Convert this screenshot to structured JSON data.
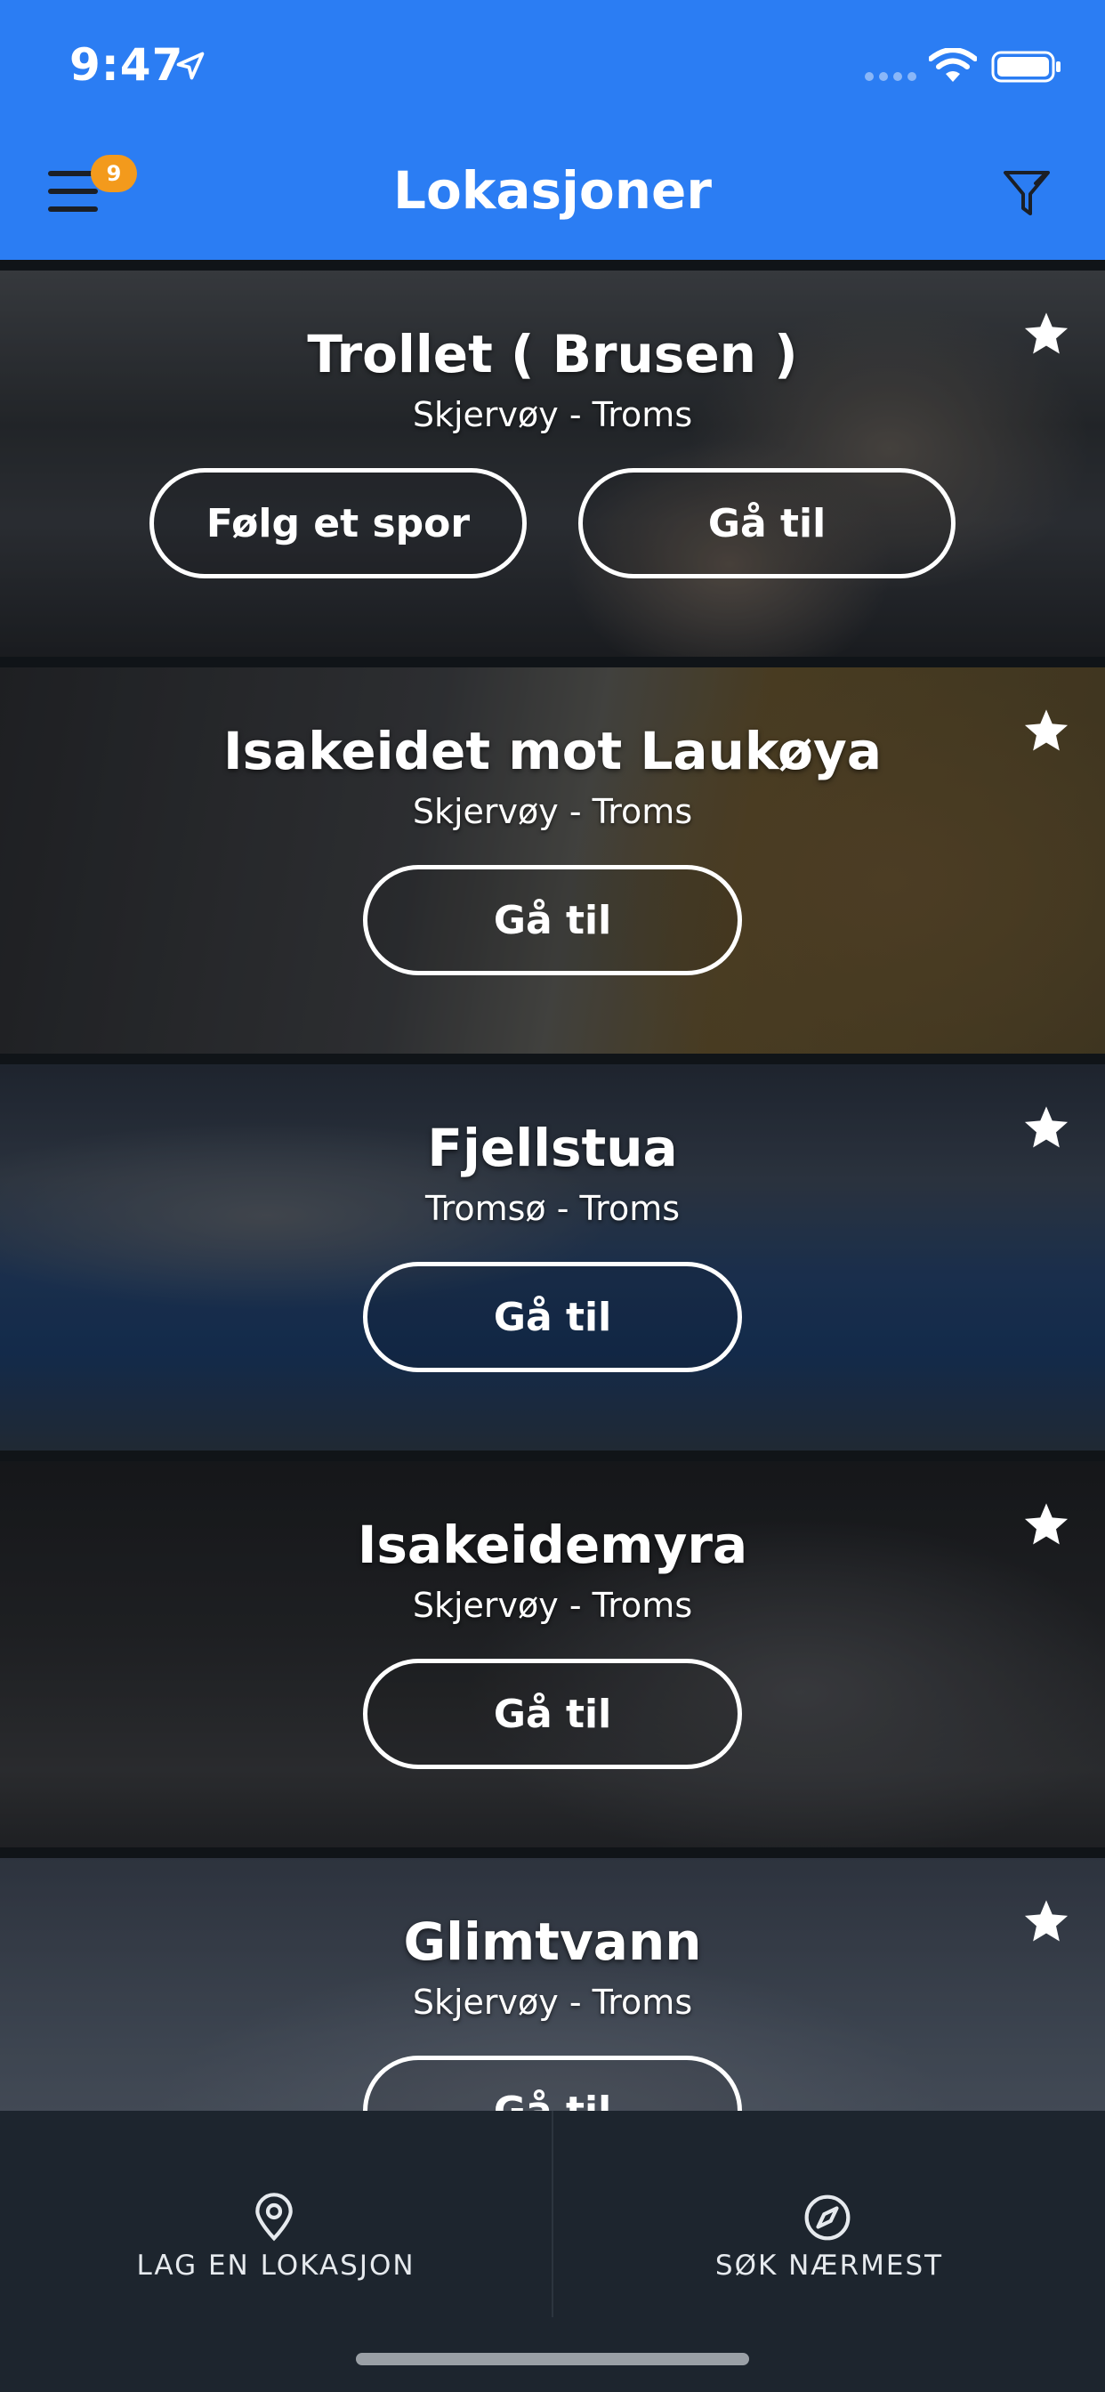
{
  "status_bar": {
    "time": "9:47"
  },
  "header": {
    "title": "Lokasjoner",
    "badge_count": "9",
    "color": "#2b7df3",
    "badge_color": "#f39a1c"
  },
  "locations": [
    {
      "name": "Trollet ( Brusen )",
      "region": "Skjervøy - Troms",
      "buttons": [
        "Følg et spor",
        "Gå til"
      ]
    },
    {
      "name": "Isakeidet mot Laukøya",
      "region": "Skjervøy - Troms",
      "buttons": [
        "Gå til"
      ]
    },
    {
      "name": "Fjellstua",
      "region": "Tromsø - Troms",
      "buttons": [
        "Gå til"
      ]
    },
    {
      "name": "Isakeidemyra",
      "region": "Skjervøy - Troms",
      "buttons": [
        "Gå til"
      ]
    },
    {
      "name": "Glimtvann",
      "region": "Skjervøy - Troms",
      "buttons": [
        "Gå til"
      ]
    }
  ],
  "bottom_bar": {
    "left_label": "LAG EN LOKASJON",
    "left_icon": "map-pin-icon",
    "right_label": "SØK NÆRMEST",
    "right_icon": "compass-icon"
  }
}
